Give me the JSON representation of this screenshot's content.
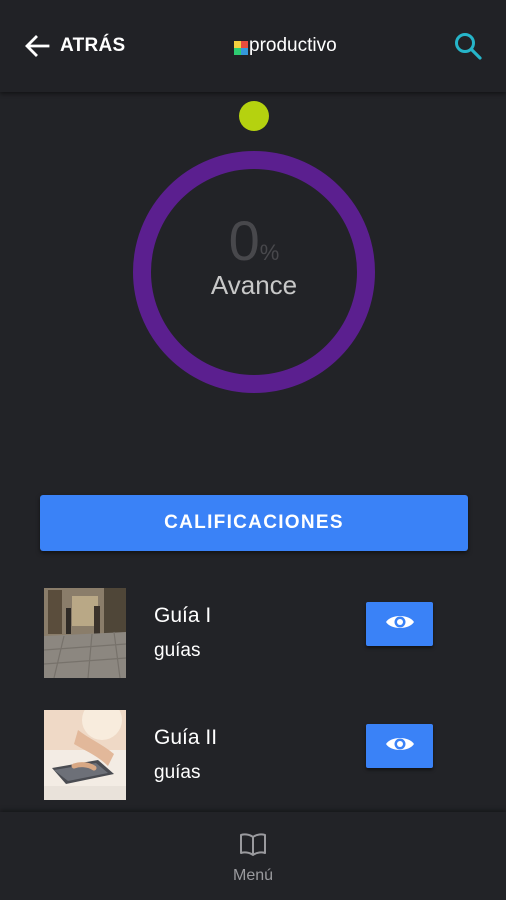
{
  "header": {
    "back_label": "ATRÁS",
    "brand_name": "productivo",
    "brand_logo_colors": [
      "#f4d03f",
      "#e74c3c",
      "#2ecc71",
      "#3498db"
    ],
    "search_icon": "search-icon"
  },
  "progress": {
    "value": "0",
    "unit": "%",
    "fraction": 0,
    "label": "Avance",
    "ring_color": "#5b1f8f",
    "knob_color": "#b5d20f"
  },
  "grades": {
    "label": "CALIFICACIONES"
  },
  "guides": [
    {
      "title": "Guía I",
      "type": "guías",
      "thumbnail": "street-photo",
      "action_icon": "eye-icon"
    },
    {
      "title": "Guía II",
      "type": "guías",
      "thumbnail": "laptop-photo",
      "action_icon": "eye-icon"
    }
  ],
  "bottom_nav": {
    "menu_label": "Menú",
    "menu_icon": "book-icon"
  },
  "colors": {
    "background": "#222327",
    "accent": "#3a82f7",
    "search_accent": "#26b5c9"
  }
}
